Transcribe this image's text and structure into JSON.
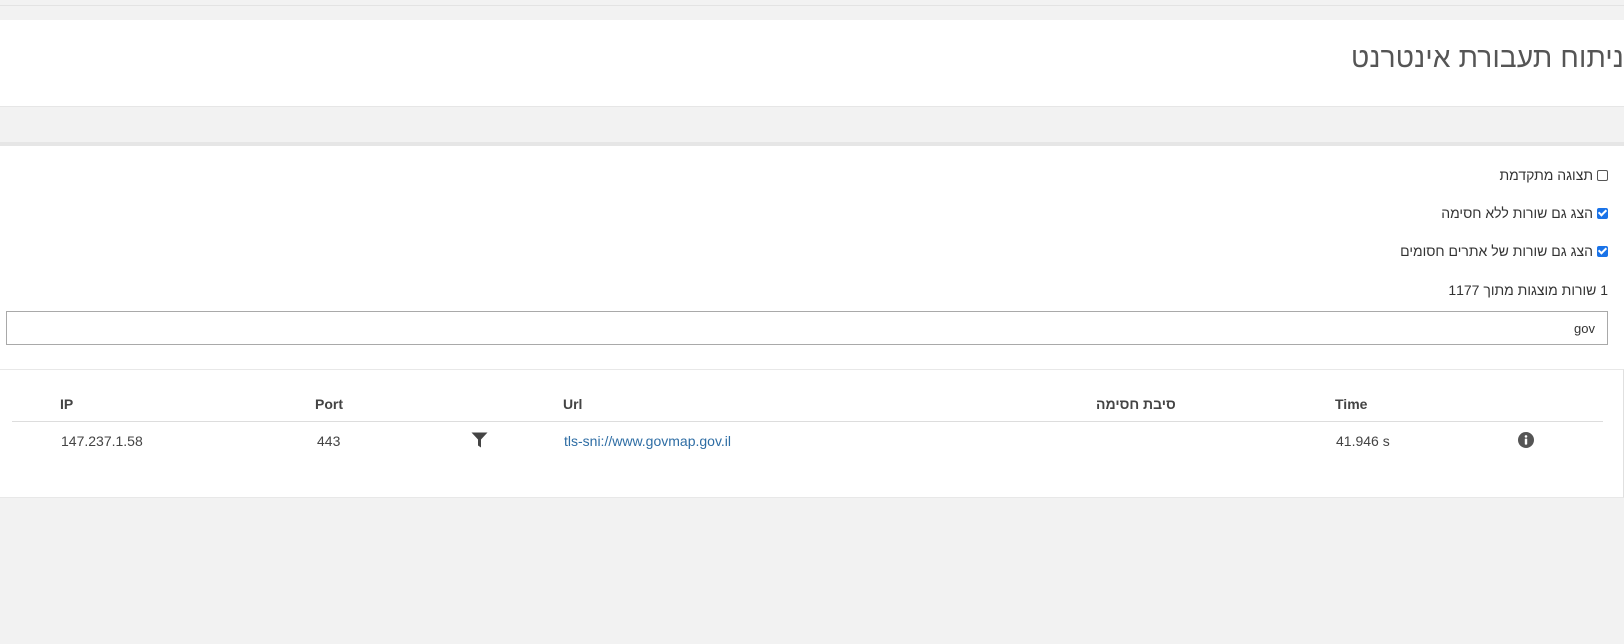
{
  "header": {
    "title": "ניתוח תעבורת אינטרנט"
  },
  "options": [
    {
      "label": "תצוגה מתקדמת",
      "checked": false
    },
    {
      "label": "הצג גם שורות ללא חסימה",
      "checked": true
    },
    {
      "label": "הצג גם שורות של אתרים חסומים",
      "checked": true
    }
  ],
  "summary": {
    "rows_shown": "1 שורות מוצגות מתוך 1177"
  },
  "search": {
    "value": "gov",
    "placeholder": ""
  },
  "table": {
    "columns": {
      "ip": "IP",
      "port": "Port",
      "url": "Url",
      "block_reason": "סיבת חסימה",
      "time": "Time"
    },
    "rows": [
      {
        "ip": "147.237.1.58",
        "port": "443",
        "filter_icon": "filter-icon",
        "url": "tls-sni://www.govmap.gov.il",
        "block_reason": "",
        "time": "41.946 s",
        "info_icon": "info-circle-icon"
      }
    ]
  },
  "colors": {
    "link": "#2e6da4",
    "checkbox_checked": "#1a73e8",
    "background": "#f2f2f2"
  }
}
